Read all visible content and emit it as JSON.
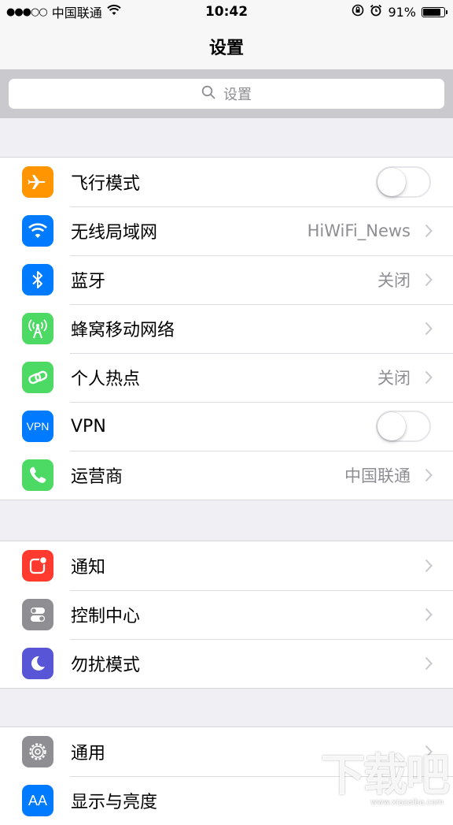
{
  "status_bar": {
    "signal_dots": "●●●○○",
    "carrier": "中国联通",
    "time": "10:42",
    "battery_percent": "91%",
    "battery_level": 0.91
  },
  "nav": {
    "title": "设置"
  },
  "search": {
    "placeholder": "设置"
  },
  "group1": [
    {
      "label": "飞行模式",
      "icon": "airplane-icon",
      "color": "#ff9500",
      "toggle": false
    },
    {
      "label": "无线局域网",
      "icon": "wifi-icon",
      "color": "#007aff",
      "value": "HiWiFi_News"
    },
    {
      "label": "蓝牙",
      "icon": "bluetooth-icon",
      "color": "#007aff",
      "value": "关闭"
    },
    {
      "label": "蜂窝移动网络",
      "icon": "cellular-antenna-icon",
      "color": "#4cd964",
      "value": ""
    },
    {
      "label": "个人热点",
      "icon": "hotspot-chain-icon",
      "color": "#4cd964",
      "value": "关闭"
    },
    {
      "label": "VPN",
      "icon": "vpn-icon",
      "icon_text": "VPN",
      "color": "#007aff",
      "toggle": false
    },
    {
      "label": "运营商",
      "icon": "phone-icon",
      "color": "#4cd964",
      "value": "中国联通"
    }
  ],
  "group2": [
    {
      "label": "通知",
      "icon": "notification-icon",
      "color": "#ff3b30"
    },
    {
      "label": "控制中心",
      "icon": "control-center-icon",
      "color": "#8e8e93"
    },
    {
      "label": "勿扰模式",
      "icon": "moon-icon",
      "color": "#5856d6"
    }
  ],
  "group3": [
    {
      "label": "通用",
      "icon": "gear-icon",
      "color": "#8e8e93"
    },
    {
      "label": "显示与亮度",
      "icon": "display-brightness-icon",
      "icon_text": "AA",
      "color": "#007aff"
    }
  ],
  "watermark": {
    "text": "下载吧",
    "sub": "www.xiazaiba.com"
  }
}
